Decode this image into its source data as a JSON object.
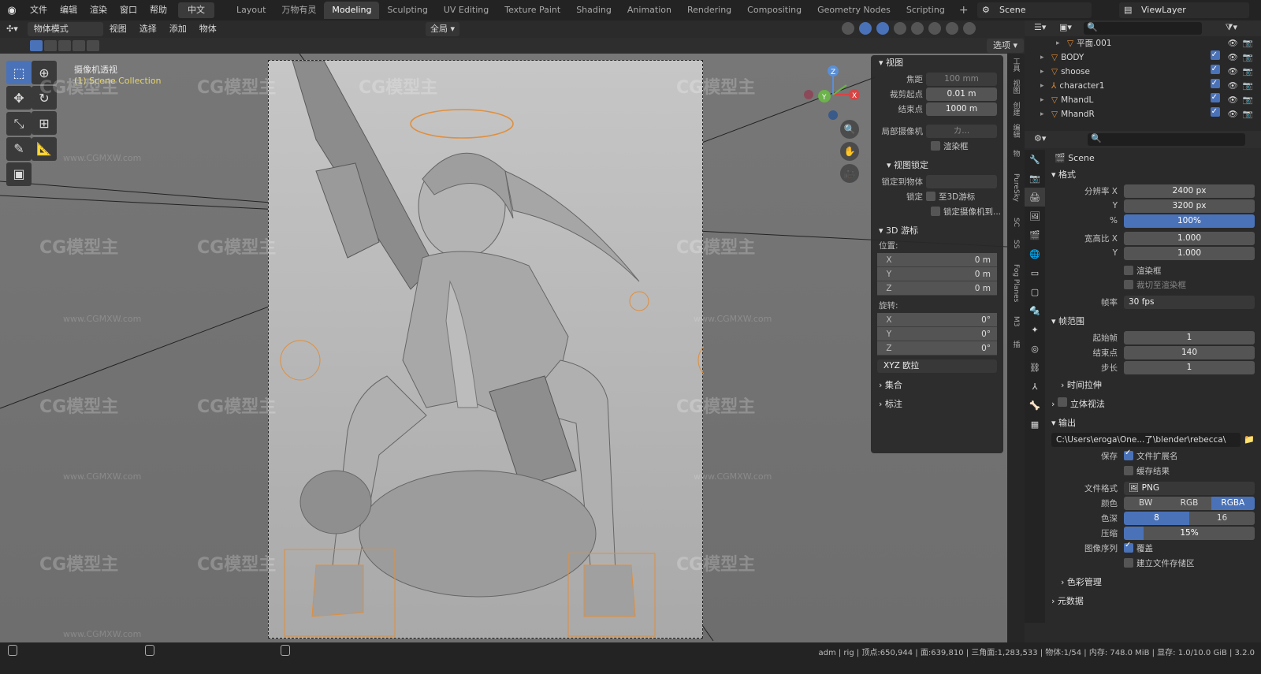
{
  "topbar": {
    "menu": [
      "文件",
      "编辑",
      "渲染",
      "窗口",
      "帮助"
    ],
    "language": "中文",
    "workspaces": [
      "Layout",
      "万物有灵",
      "Modeling",
      "Sculpting",
      "UV Editing",
      "Texture Paint",
      "Shading",
      "Animation",
      "Rendering",
      "Compositing",
      "Geometry Nodes",
      "Scripting"
    ],
    "active_workspace": "Modeling",
    "scene": "Scene",
    "view_layer": "ViewLayer"
  },
  "viewport_header": {
    "mode": "物体模式",
    "menus": [
      "视图",
      "选择",
      "添加",
      "物体"
    ],
    "transform_orientation": "全局",
    "options": "选项"
  },
  "viewport": {
    "view_name": "摄像机透视",
    "collection_info": "(1) Scene Collection",
    "axis_labels": [
      "Z",
      "Y",
      "X"
    ],
    "watermark": "CG模型主",
    "watermark_url": "www.CGMXW.com"
  },
  "npanel": {
    "view_section": "视图",
    "focal_label": "焦距",
    "focal_value": "100 mm",
    "clip_start_label": "裁剪起点",
    "clip_start_value": "0.01 m",
    "clip_end_label": "结束点",
    "clip_end_value": "1000 m",
    "local_camera_label": "局部摄像机",
    "local_camera_value": "カ...",
    "render_region_label": "渲染框",
    "view_lock_section": "视图锁定",
    "lock_to_object_label": "锁定到物体",
    "lock_label": "锁定",
    "lock_cursor_label": "至3D游标",
    "lock_camera_label": "锁定摄像机到...",
    "cursor_section": "3D 游标",
    "location_label": "位置:",
    "location": [
      {
        "k": "X",
        "v": "0 m"
      },
      {
        "k": "Y",
        "v": "0 m"
      },
      {
        "k": "Z",
        "v": "0 m"
      }
    ],
    "rotation_label": "旋转:",
    "rotation": [
      {
        "k": "X",
        "v": "0°"
      },
      {
        "k": "Y",
        "v": "0°"
      },
      {
        "k": "Z",
        "v": "0°"
      }
    ],
    "rotation_mode": "XYZ 欧拉",
    "collection_section": "集合",
    "annotation_section": "标注"
  },
  "side_tabs": [
    "工具",
    "视图",
    "创建",
    "编辑",
    "物",
    "PureSky",
    "SC",
    "SS",
    "Fog Planes",
    "M3",
    "插"
  ],
  "outliner": {
    "rows": [
      {
        "name": "平面.001",
        "visible": true
      },
      {
        "name": "BODY",
        "visible": true
      },
      {
        "name": "shoose",
        "visible": true
      },
      {
        "name": "character1",
        "visible": true
      },
      {
        "name": "MhandL",
        "visible": true
      },
      {
        "name": "MhandR",
        "visible": true
      }
    ]
  },
  "properties": {
    "scene_name": "Scene",
    "format_section": "格式",
    "res_x_label": "分辨率 X",
    "res_x": "2400 px",
    "res_y_label": "Y",
    "res_y": "3200 px",
    "res_pct_label": "%",
    "res_pct": "100%",
    "aspect_x_label": "宽高比 X",
    "aspect_x": "1.000",
    "aspect_y_label": "Y",
    "aspect_y": "1.000",
    "render_region": "渲染框",
    "crop_region": "裁切至渲染框",
    "fps_label": "帧率",
    "fps": "30 fps",
    "frame_range_section": "帧范围",
    "frame_start_label": "起始帧",
    "frame_start": "1",
    "frame_end_label": "结束点",
    "frame_end": "140",
    "frame_step_label": "步长",
    "frame_step": "1",
    "time_stretch": "时间拉伸",
    "stereoscopy": "立体视法",
    "output_section": "输出",
    "output_path": "C:\\Users\\eroga\\One...了\\blender\\rebecca\\",
    "save_label": "保存",
    "file_ext": "文件扩展名",
    "cache_result": "缓存结果",
    "file_format_label": "文件格式",
    "file_format": "PNG",
    "color_label": "颜色",
    "color_modes": [
      "BW",
      "RGB",
      "RGBA"
    ],
    "color_active": "RGBA",
    "depth_label": "色深",
    "depths": [
      "8",
      "16"
    ],
    "depth_active": "8",
    "compression_label": "压缩",
    "compression": "15%",
    "compression_fraction": 0.15,
    "sequence_label": "图像序列",
    "overwrite": "覆盖",
    "placeholders": "建立文件存储区",
    "color_management": "色彩管理",
    "metadata": "元数据"
  },
  "status": {
    "text": "adm | rig | 顶点:650,944 | 面:639,810 | 三角面:1,283,533 | 物体:1/54 | 内存: 748.0 MiB | 显存: 1.0/10.0 GiB | 3.2.0"
  },
  "colors": {
    "accent": "#4a72b8",
    "orange": "#e08e3c",
    "bg": "#1d1d1d"
  }
}
